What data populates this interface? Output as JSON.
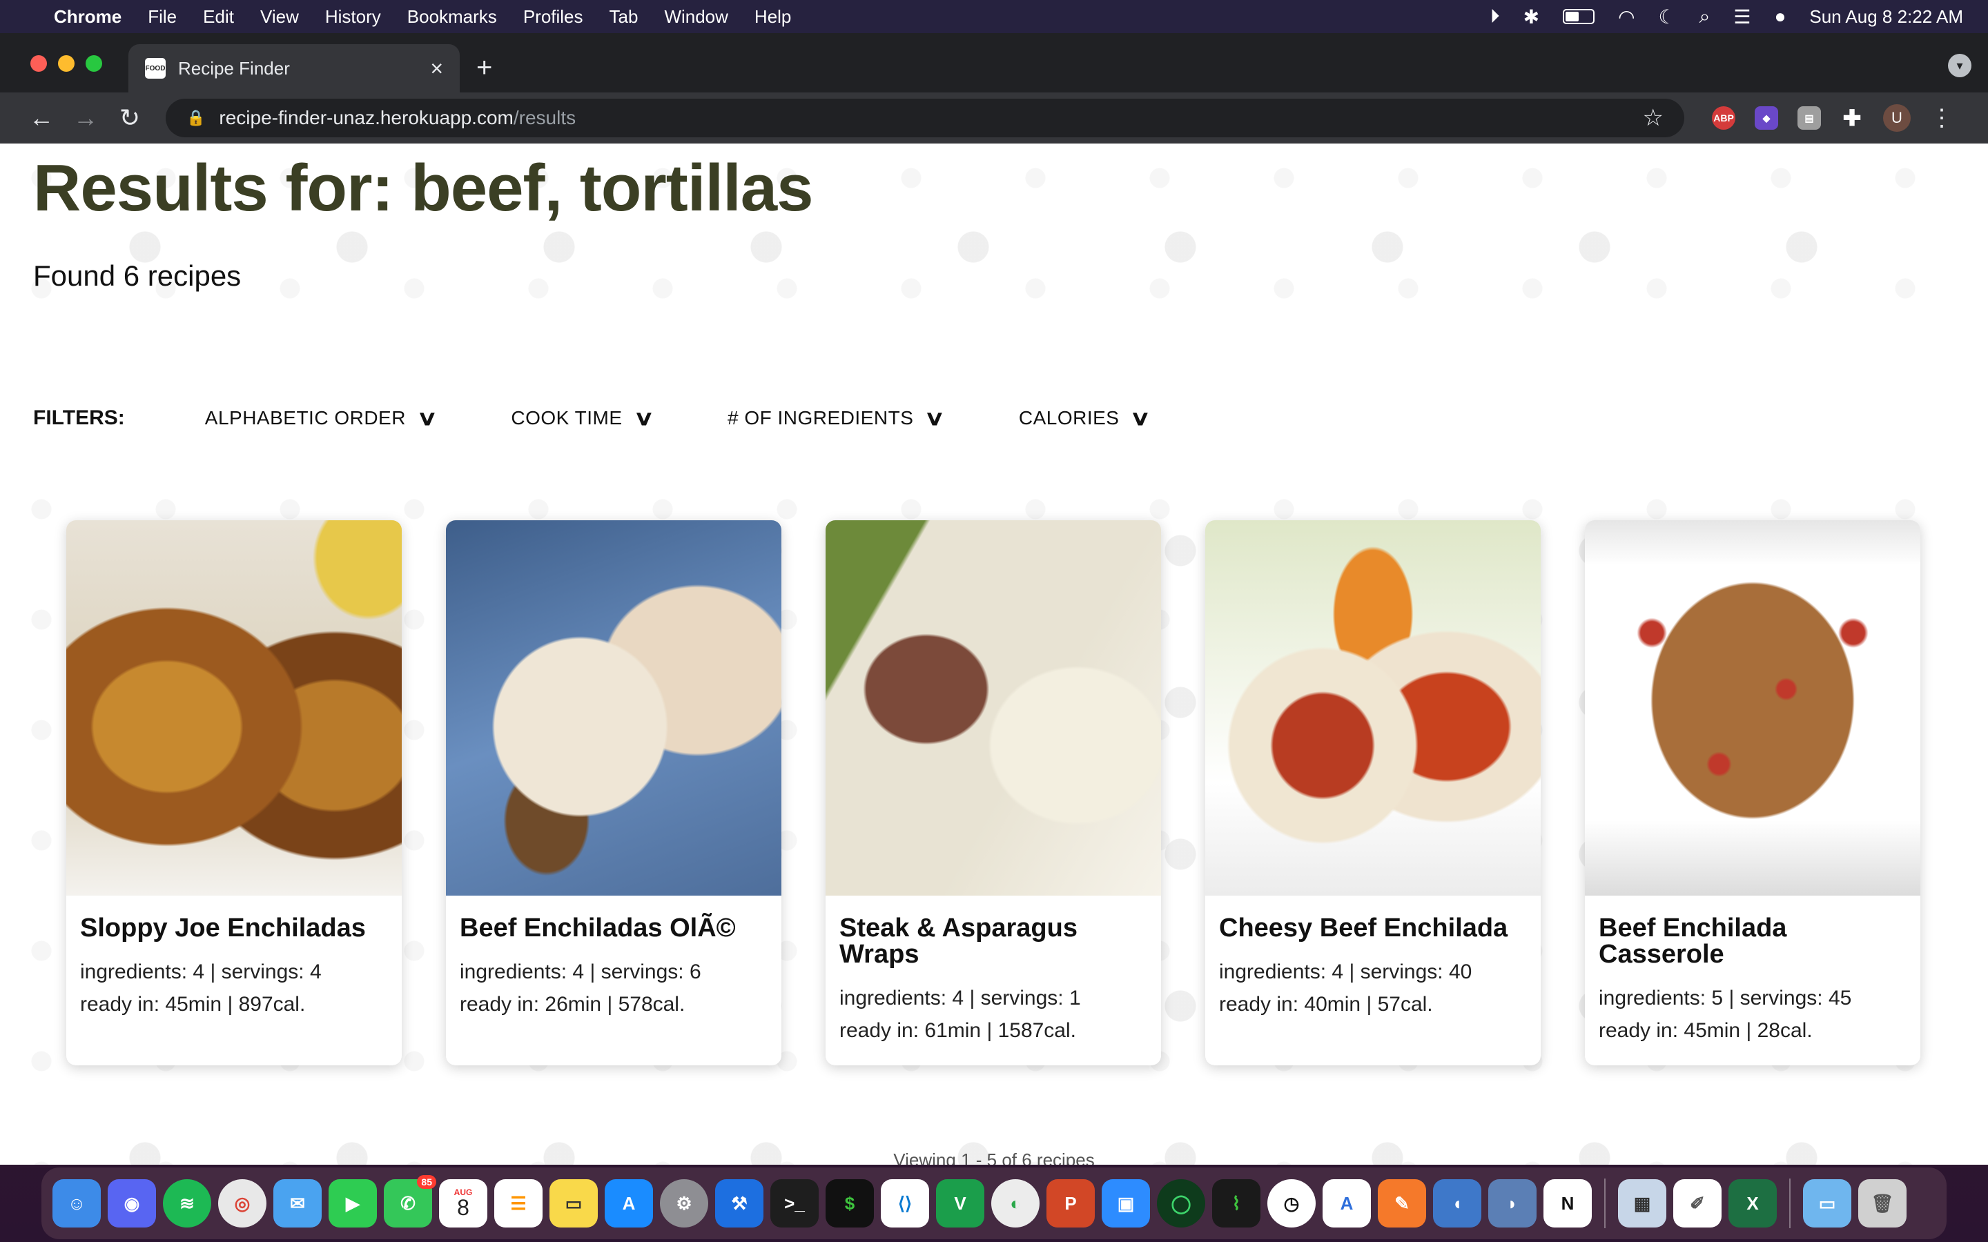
{
  "menubar": {
    "app": "Chrome",
    "items": [
      "File",
      "Edit",
      "View",
      "History",
      "Bookmarks",
      "Profiles",
      "Tab",
      "Window",
      "Help"
    ],
    "datetime": "Sun Aug 8  2:22 AM"
  },
  "browser": {
    "tab_title": "Recipe Finder",
    "url_host": "recipe-finder-unaz.herokuapp.com",
    "url_path": "/results",
    "favicon_text": "FOOD",
    "profile_initial": "U",
    "ext_abp": "ABP"
  },
  "page": {
    "title": "Results for: beef, tortillas",
    "found": "Found 6 recipes",
    "filters_label": "FILTERS:",
    "filters": [
      {
        "label": "ALPHABETIC ORDER"
      },
      {
        "label": "COOK TIME"
      },
      {
        "label": "# OF INGREDIENTS"
      },
      {
        "label": "CALORIES"
      }
    ],
    "recipes": [
      {
        "name": "Sloppy Joe Enchiladas",
        "line1": "ingredients: 4 | servings: 4",
        "line2": "ready in: 45min | 897cal."
      },
      {
        "name": "Beef Enchiladas OlÃ©",
        "line1": "ingredients: 4 | servings: 6",
        "line2": "ready in: 26min | 578cal."
      },
      {
        "name": "Steak & Asparagus Wraps",
        "line1": "ingredients: 4 | servings: 1",
        "line2": "ready in: 61min | 1587cal."
      },
      {
        "name": "Cheesy Beef Enchilada",
        "line1": "ingredients: 4 | servings: 40",
        "line2": "ready in: 40min | 57cal."
      },
      {
        "name": "Beef Enchilada Casserole",
        "line1": "ingredients: 5 | servings: 45",
        "line2": "ready in: 45min | 28cal."
      }
    ],
    "viewing": "Viewing 1 - 5 of 6 recipes"
  },
  "dock": {
    "calendar_month": "AUG",
    "calendar_day": "8",
    "messages_badge": "85"
  },
  "colors": {
    "title": "#3b3f24",
    "chrome_dark": "#202124",
    "chrome_toolbar": "#35363a"
  }
}
